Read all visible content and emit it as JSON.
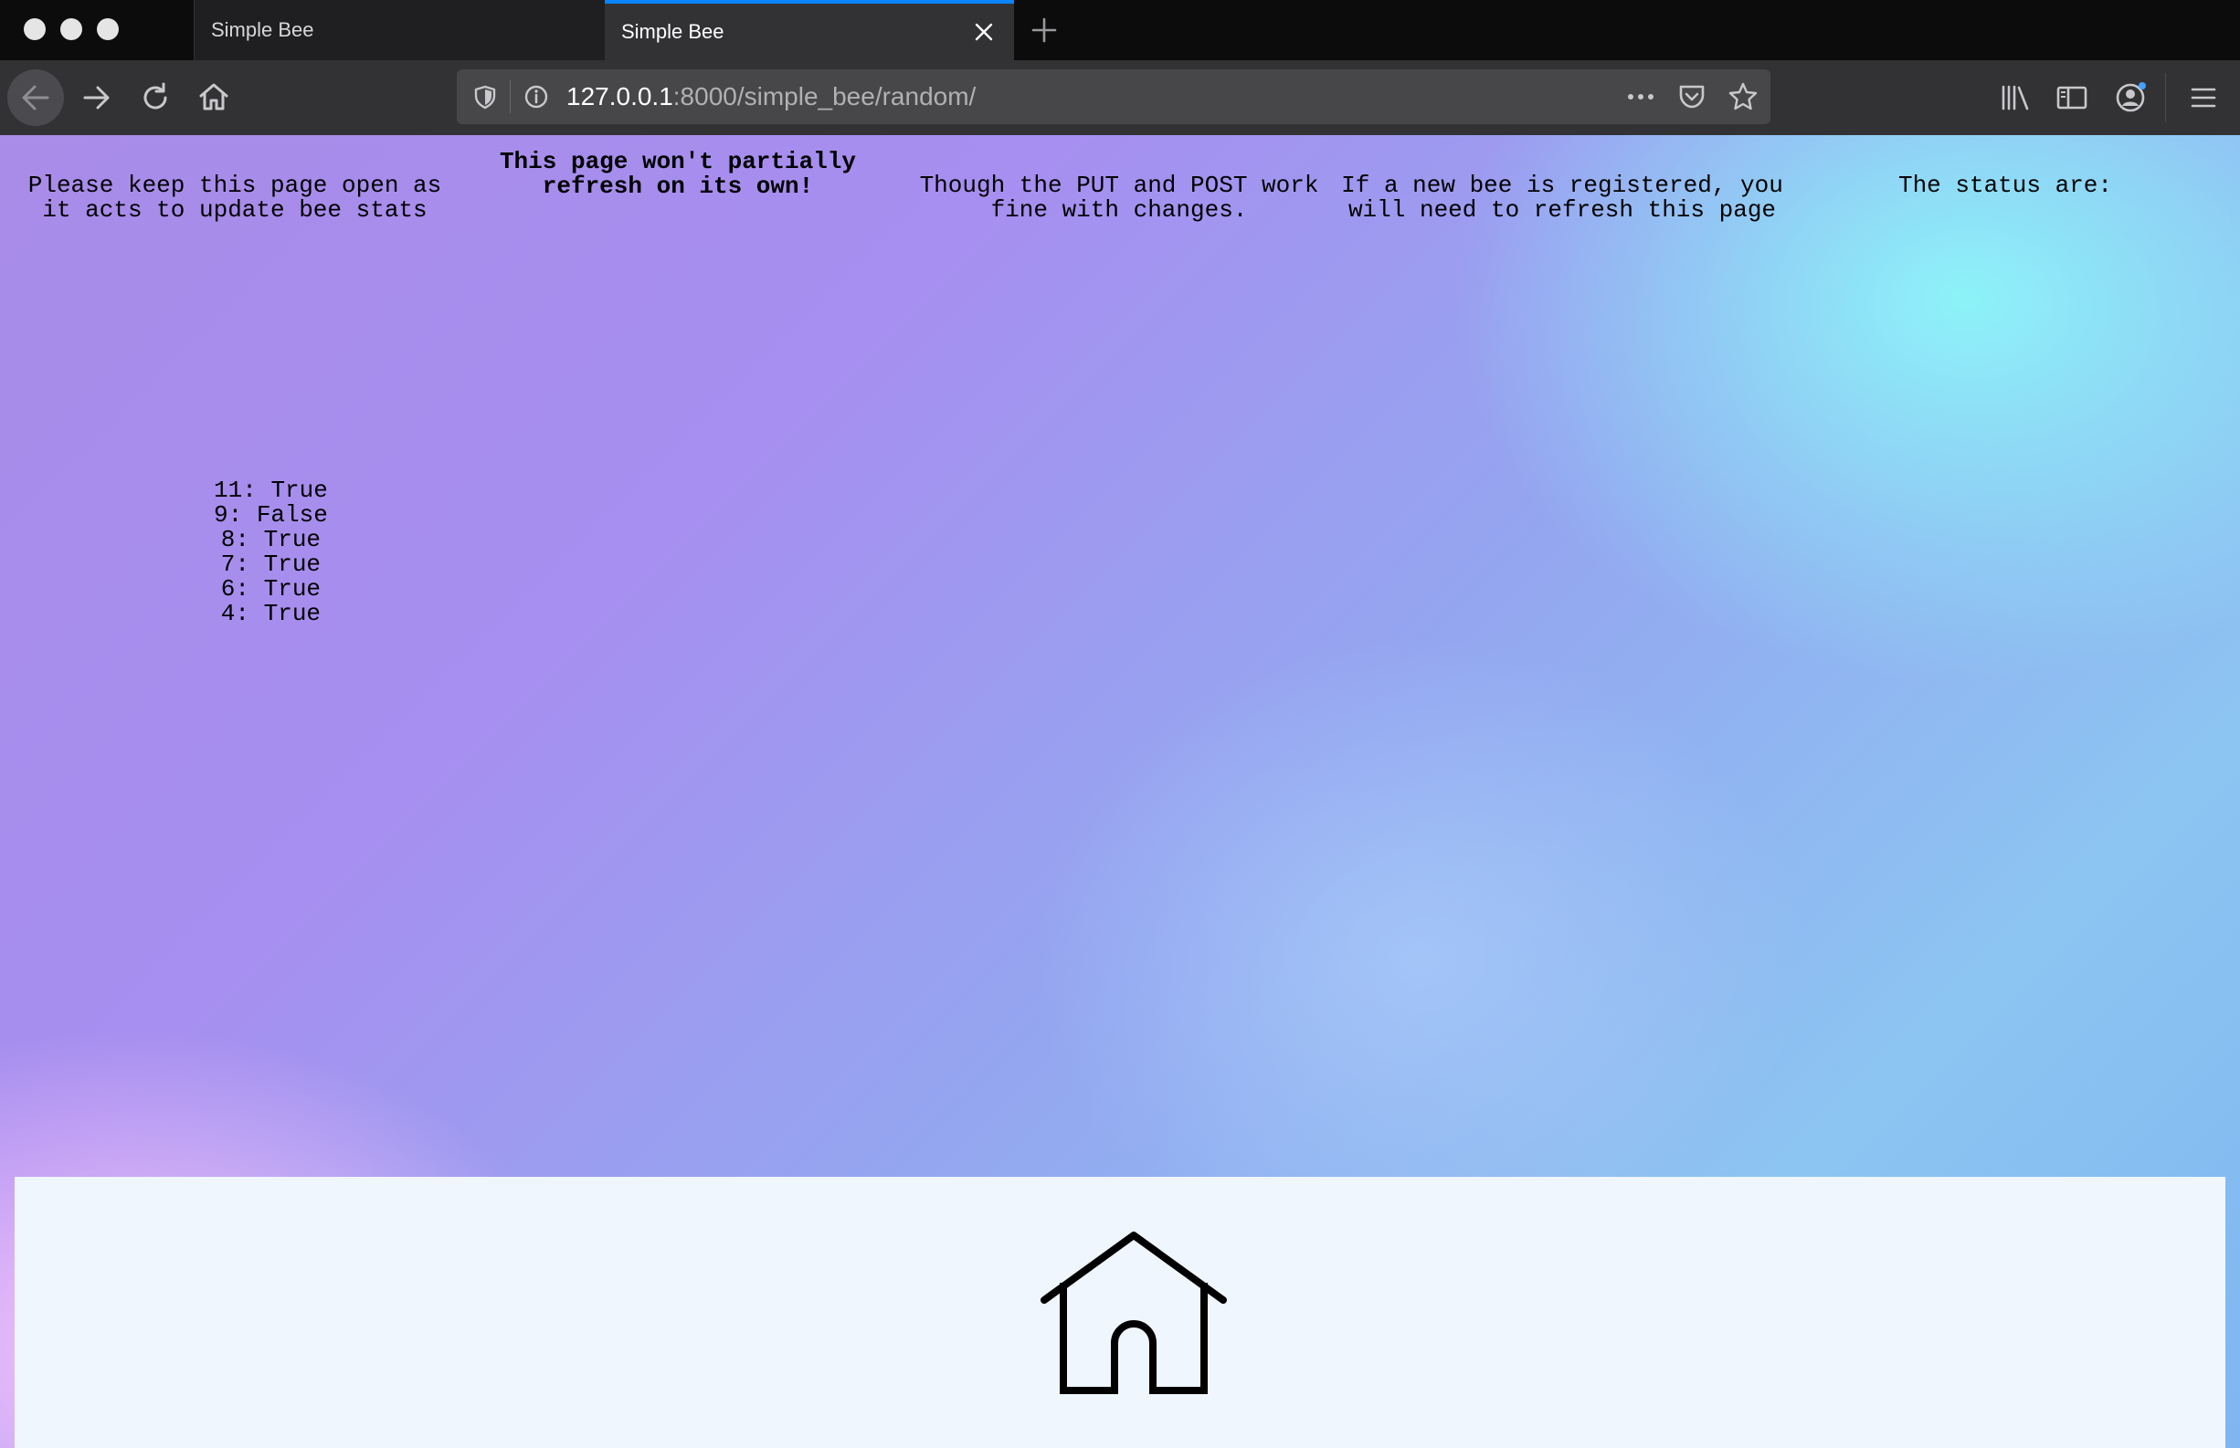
{
  "browser": {
    "tabs": [
      {
        "title": "Simple Bee",
        "active": false
      },
      {
        "title": "Simple Bee",
        "active": true
      }
    ],
    "url": {
      "host": "127.0.0.1",
      "rest": ":8000/simple_bee/random/"
    },
    "accent_color": "#0a84ff"
  },
  "page": {
    "notes": [
      "Please keep this page open as it acts to update bee stats",
      "This page won't partially refresh on its own!",
      "Though the PUT and POST work fine with changes.",
      "If a new bee is registered, you will need to refresh this page",
      "The status are:"
    ],
    "statuses": [
      {
        "id": "11",
        "value": "True"
      },
      {
        "id": "9",
        "value": "False"
      },
      {
        "id": "8",
        "value": "True"
      },
      {
        "id": "7",
        "value": "True"
      },
      {
        "id": "6",
        "value": "True"
      },
      {
        "id": "4",
        "value": "True"
      }
    ],
    "footer_icon": "home-icon"
  }
}
